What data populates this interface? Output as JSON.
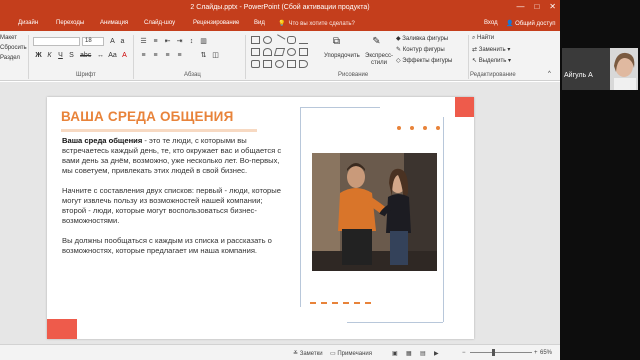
{
  "window": {
    "title": "2 Слайды.pptx - PowerPoint (Сбой активации продукта)",
    "help_icon": "?",
    "minimize_icon": "—",
    "restore_icon": "□",
    "close_icon": "✕"
  },
  "tabs": [
    "Дизайн",
    "Переходы",
    "Анимация",
    "Слайд-шоу",
    "Рецензирование",
    "Вид"
  ],
  "tell_me": "Что вы хотите сделать?",
  "signin": "Вход",
  "share": "Общий доступ",
  "ribbon": {
    "layout": "Макет",
    "reset": "Сбросить",
    "section": "Раздел",
    "font_size": "18",
    "font_group": "Шрифт",
    "paragraph_group": "Абзац",
    "arrange": "Упорядочить",
    "quick_styles": "Экспресс-стили",
    "drawing_group": "Рисование",
    "shape_fill": "Заливка фигуры",
    "shape_outline": "Контур фигуры",
    "shape_effects": "Эффекты фигуры",
    "find": "Найти",
    "replace": "Заменить",
    "select": "Выделить",
    "editing_group": "Редактирование"
  },
  "slide": {
    "title": "ВАША СРЕДА ОБЩЕНИЯ",
    "p1_bold": "Ваша среда общения",
    "p1_rest": " - это те люди, с которыми вы встречаетесь каждый день, те, кто окружает вас и общается с вами день за днём, возможно, уже несколько лет. Во-первых, мы советуем, привлекать этих людей в свой бизнес.",
    "p2": "Начните с составления двух списков: первый - люди, которые могут извлечь пользу из возможностей нашей компании; второй - люди, которые могут воспользоваться бизнес-возможностями.",
    "p3": "Вы должны пообщаться с каждым из списка и рассказать о возможностях, которые предлагает им наша компания."
  },
  "status": {
    "notes": "Заметки",
    "comments": "Примечания",
    "zoom": "65%"
  },
  "webcam": {
    "name": "Айгуль А"
  },
  "colors": {
    "accent_red": "#c43e1c",
    "title_orange": "#e8833a",
    "coral": "#ee5b4b"
  }
}
